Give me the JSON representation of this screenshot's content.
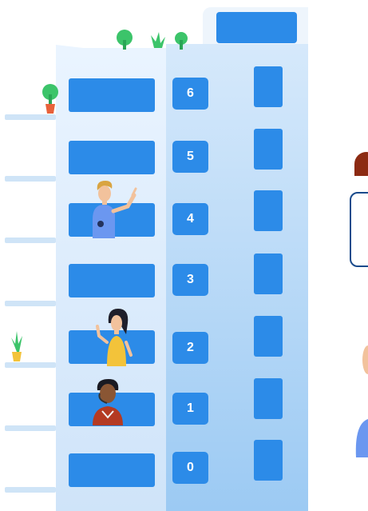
{
  "floors": [
    {
      "number": "6"
    },
    {
      "number": "5"
    },
    {
      "number": "4"
    },
    {
      "number": "3"
    },
    {
      "number": "2"
    },
    {
      "number": "1"
    },
    {
      "number": "0"
    }
  ],
  "colors": {
    "button": "#2c8be8",
    "building_light": "#eaf4ff",
    "building_dark": "#9ccaf3",
    "ledge": "#cfe4f7",
    "dialog_border": "#1a4b8c"
  },
  "icons": [
    "plant-icon",
    "person-figure"
  ]
}
